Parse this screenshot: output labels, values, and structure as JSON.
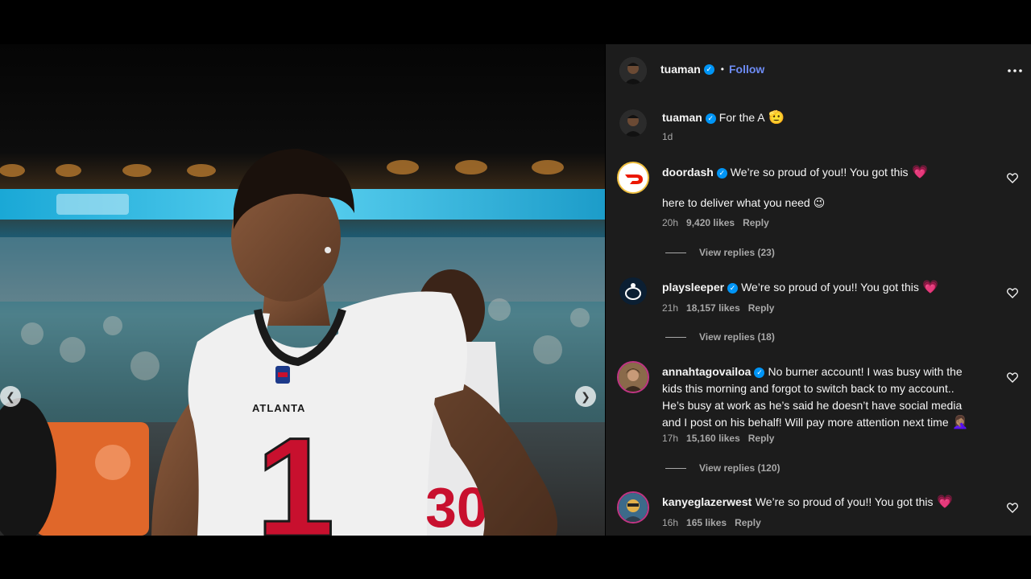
{
  "header": {
    "username": "tuaman",
    "follow_label": "Follow",
    "dot": "•",
    "more_icon": "more-horizontal-icon"
  },
  "caption": {
    "username": "tuaman",
    "text": "For the A",
    "emoji": "🫡",
    "time": "1d"
  },
  "comments": [
    {
      "username": "doordash",
      "verified": true,
      "text": "We’re so proud of you!! You got this",
      "emoji": "💗",
      "text2": "here to deliver what you need",
      "emoji2": "😉",
      "time": "20h",
      "likes": "9,420 likes",
      "reply_label": "Reply",
      "view_replies": "View replies (23)"
    },
    {
      "username": "playsleeper",
      "verified": true,
      "text": "We’re so proud of you!! You got this",
      "emoji": "💗",
      "time": "21h",
      "likes": "18,157 likes",
      "reply_label": "Reply",
      "view_replies": "View replies (18)"
    },
    {
      "username": "annahtagovailoa",
      "verified": true,
      "text_lines": [
        "No burner account! I was busy with the",
        "kids this morning and forgot to switch back to my account..",
        "He’s busy at work as he’s said he doesn’t have social media",
        "and I post on his behalf! Will pay more attention next time"
      ],
      "emoji": "🤦🏽‍♀️",
      "time": "17h",
      "likes": "15,160 likes",
      "reply_label": "Reply",
      "view_replies": "View replies (120)"
    },
    {
      "username": "kanyeglazerwest",
      "verified": false,
      "text": "We’re so proud of you!! You got this",
      "emoji": "💗",
      "time": "16h",
      "likes": "165 likes",
      "reply_label": "Reply"
    }
  ],
  "photo": {
    "jersey_team": "ATLANTA",
    "jersey_number": "1",
    "prev_icon": "chevron-left-icon",
    "next_icon": "chevron-right-icon"
  },
  "colors": {
    "panel_bg": "#1c1c1c",
    "link_blue": "#6e8cf5",
    "verified_blue": "#0095f6",
    "muted": "#a8a8a8",
    "jersey_red": "#c8102e"
  }
}
